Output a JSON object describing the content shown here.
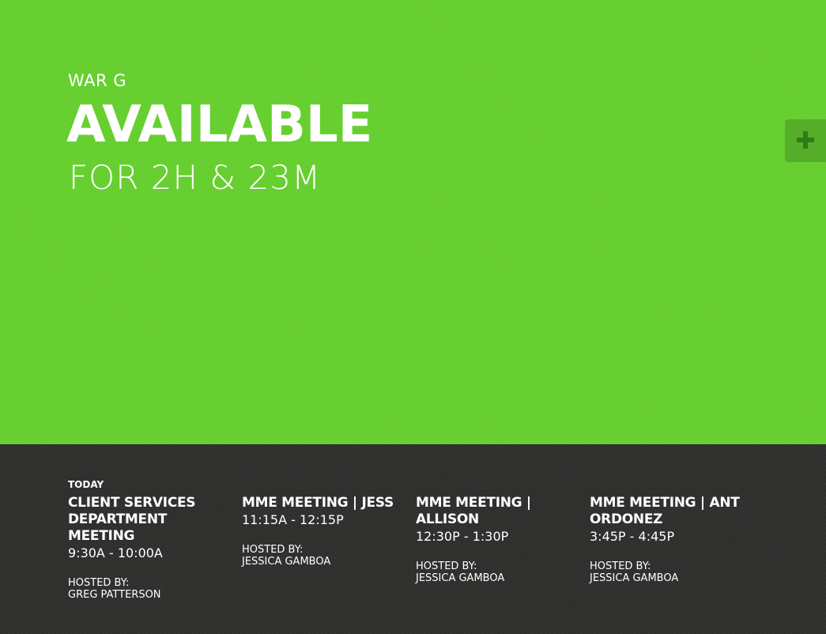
{
  "room": {
    "name": "WAR G",
    "status": "AVAILABLE",
    "duration": "FOR 2H & 23M"
  },
  "colors": {
    "available_bg": "#66cf2f",
    "add_button_bg": "#56ad2a",
    "add_icon": "#2f7a1a",
    "schedule_bg": "#2e302d",
    "text": "#ffffff"
  },
  "add_button": {
    "icon": "plus-icon"
  },
  "schedule": {
    "day_label": "TODAY",
    "meetings": [
      {
        "title": "CLIENT SERVICES DEPARTMENT MEETING",
        "time": "9:30A - 10:00A",
        "hosted_label": "HOSTED BY:",
        "host": "GREG PATTERSON"
      },
      {
        "title": "MME MEETING | JESS",
        "time": "11:15A - 12:15P",
        "hosted_label": "HOSTED BY:",
        "host": "JESSICA GAMBOA"
      },
      {
        "title": "MME MEETING | ALLISON",
        "time": "12:30P - 1:30P",
        "hosted_label": "HOSTED BY:",
        "host": "JESSICA GAMBOA"
      },
      {
        "title": "MME MEETING | ANT ORDONEZ",
        "time": "3:45P - 4:45P",
        "hosted_label": "HOSTED BY:",
        "host": "JESSICA GAMBOA"
      }
    ]
  }
}
